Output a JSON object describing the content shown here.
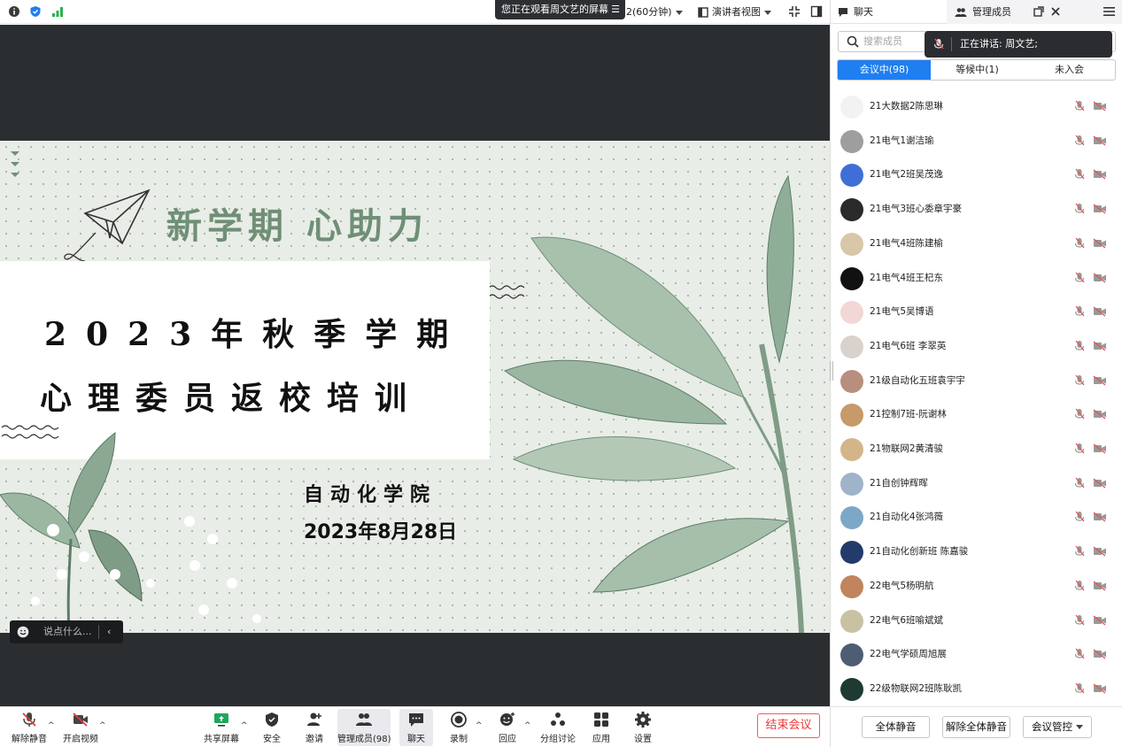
{
  "topbar": {
    "screen_banner": "您正在观看周文艺的屏幕",
    "duration": "2(60分钟)",
    "view_mode": "演讲者视图"
  },
  "slide": {
    "slogan": "新学期  心助力",
    "title_line1": "2023年秋季学期",
    "title_line2": "心理委员返校培训",
    "college": "自动化学院",
    "date": "2023年8月28日"
  },
  "chat_input": {
    "placeholder": "说点什么..."
  },
  "toolbar": {
    "unmute": "解除静音",
    "start_video": "开启视频",
    "share_screen": "共享屏幕",
    "security": "安全",
    "invite": "邀请",
    "manage_members": "管理成员(98)",
    "chat": "聊天",
    "record": "录制",
    "react": "回应",
    "breakout": "分组讨论",
    "apps": "应用",
    "settings": "设置",
    "end_meeting": "结束会议"
  },
  "panel": {
    "tab_chat": "聊天",
    "tab_members": "管理成员",
    "search_placeholder": "搜索成员",
    "speaking": "正在讲话:  周文艺;",
    "seg_in_meeting": "会议中(98)",
    "seg_waiting": "等候中(1)",
    "seg_not_joined": "未入会",
    "members": [
      "21大数据2陈思琳",
      "21电气1谢洁瑜",
      "21电气2班吴茂逸",
      "21电气3班心委章宇豪",
      "21电气4班陈建榆",
      "21电气4班王杞东",
      "21电气5吴博语",
      "21电气6班 李翠英",
      "21级自动化五班袁宇宇",
      "21控制7班-阮谢林",
      "21物联网2黄清骏",
      "21自创钟辉晖",
      "21自动化4张鸿薇",
      "21自动化创新班 陈嘉骏",
      "22电气5杨明航",
      "22电气6班喻斌斌",
      "22电气学硕周旭展",
      "22级物联网2班陈耿凯"
    ],
    "avatar_colors": [
      "#f2f2f2",
      "#9e9e9e",
      "#3f6fd6",
      "#2a2a2a",
      "#d8c7a8",
      "#111111",
      "#f3d6d6",
      "#d9d2cc",
      "#b88f7f",
      "#c79a6a",
      "#d4b58a",
      "#9fb4c9",
      "#7da7c7",
      "#233b6b",
      "#c1845c",
      "#c9c2a2",
      "#4f5d72",
      "#1f3a32"
    ],
    "mute_all": "全体静音",
    "unmute_all": "解除全体静音",
    "meeting_control": "会议管控"
  }
}
